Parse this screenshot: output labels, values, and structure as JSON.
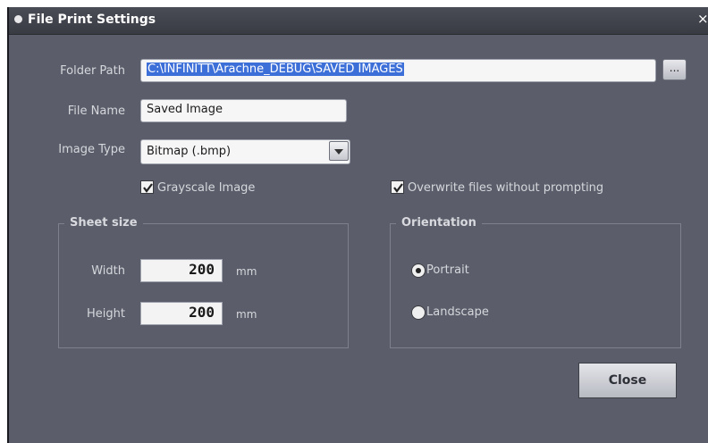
{
  "window": {
    "title": "File Print Settings",
    "close_glyph": "×"
  },
  "folder_path": {
    "label": "Folder Path",
    "value": "C:\\INFINITT\\Arachne_DEBUG\\SAVED IMAGES",
    "browse_label": "..."
  },
  "file_name": {
    "label": "File Name",
    "value": "Saved Image"
  },
  "image_type": {
    "label": "Image Type",
    "value": "Bitmap (.bmp)"
  },
  "options": {
    "grayscale": {
      "label": "Grayscale Image",
      "checked": true
    },
    "overwrite": {
      "label": "Overwrite files without prompting",
      "checked": true
    }
  },
  "sheet_size": {
    "title": "Sheet size",
    "width_label": "Width",
    "width_value": "200",
    "height_label": "Height",
    "height_value": "200",
    "unit": "mm"
  },
  "orientation": {
    "title": "Orientation",
    "portrait_label": "Portrait",
    "landscape_label": "Landscape",
    "selected": "Portrait"
  },
  "close_button": {
    "label": "Close"
  },
  "colors": {
    "background": "#5b5e6a",
    "selection": "#3d6fd8"
  }
}
